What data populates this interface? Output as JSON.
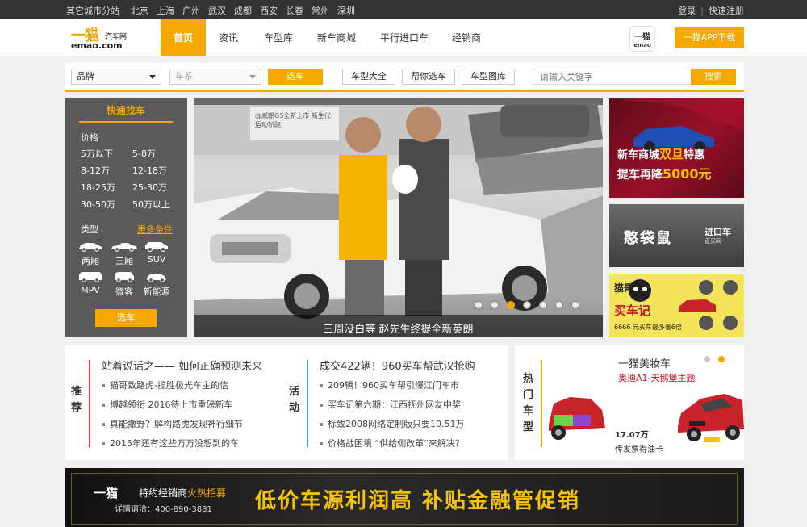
{
  "topbar": {
    "city_label": "其它城市分站",
    "cities": [
      "北京",
      "上海",
      "广州",
      "武汉",
      "成都",
      "西安",
      "长春",
      "常州",
      "深圳"
    ],
    "login": "登录",
    "register": "快速注册"
  },
  "header": {
    "logo_main": "一猫",
    "logo_sub": "汽车网",
    "logo_domain": "emao.com",
    "nav": [
      "首页",
      "资讯",
      "车型库",
      "新车商城",
      "平行进口车",
      "经销商"
    ],
    "app_icon_text": "一猫",
    "app_icon_sub": "emao",
    "app_download": "一猫APP下载"
  },
  "search": {
    "brand": "品牌",
    "series": "车系",
    "select_btn": "选车",
    "all_models": "车型大全",
    "help_select": "帮你选车",
    "gallery": "车型图库",
    "keyword_placeholder": "请输入关键字",
    "search_btn": "搜索"
  },
  "quick": {
    "title": "快速找车",
    "price_label": "价格",
    "prices": [
      "5万以下",
      "5-8万",
      "8-12万",
      "12-18万",
      "18-25万",
      "25-30万",
      "30-50万",
      "50万以上"
    ],
    "type_label": "类型",
    "more": "更多条件",
    "types": [
      "两厢",
      "三厢",
      "SUV",
      "MPV",
      "微客",
      "新能源"
    ],
    "go": "选车"
  },
  "hero": {
    "caption": "三周没白等 赵先生终提全新英朗",
    "sign_text": "@威朗GS全新上市 新生代运动轿跑",
    "dot_count": 7,
    "active_dot": 3
  },
  "banners": {
    "b1_line1": "新车商城",
    "b1_hl1": "双旦",
    "b1_tail1": "特惠",
    "b1_line2": "提车再降",
    "b1_hl2": "5000元",
    "b2_title": "憨袋鼠",
    "b2_sub1": "进口车",
    "b2_sub2": "直买网",
    "b3_line1": "猫哥",
    "b3_line2": "买车记",
    "b3_line3": "6666 元买车最多省6倍"
  },
  "news": {
    "rec_label": "推荐",
    "act_label": "活动",
    "rec_head": "站着说话之—— 如何正确预测未来",
    "rec_items": [
      "猫哥致路虎-揽胜极光车主的信",
      "博越领衔 2016待上市重磅新车",
      "真能撒野？解构路虎发现神行细节",
      "2015年还有这些万万没想到的车"
    ],
    "act_head": "成交422辆！960买车帮武汉抢购",
    "act_items": [
      "209辆！960买车帮引爆江门车市",
      "买车记第六期：江西抚州网友中奖",
      "标致2008网络定制版只要10.51万",
      "价格战困境 “供给侧改革”来解决？"
    ]
  },
  "hot": {
    "label": "热门车型",
    "name": "一猫美妆车",
    "sub": "奥迪A1-天鹅堡主题",
    "price": "17.07万",
    "gift": "传发票得油卡"
  },
  "bottom": {
    "brand": "一猫",
    "dealer": "特约经销商",
    "hot_recruit": "火热招募",
    "phone": "详情请洽：400-890-3881",
    "slogan": "低价车源利润高 补贴金融管促销"
  },
  "colors": {
    "accent": "#f5a800",
    "dark": "#333333",
    "red": "#c0101e"
  }
}
